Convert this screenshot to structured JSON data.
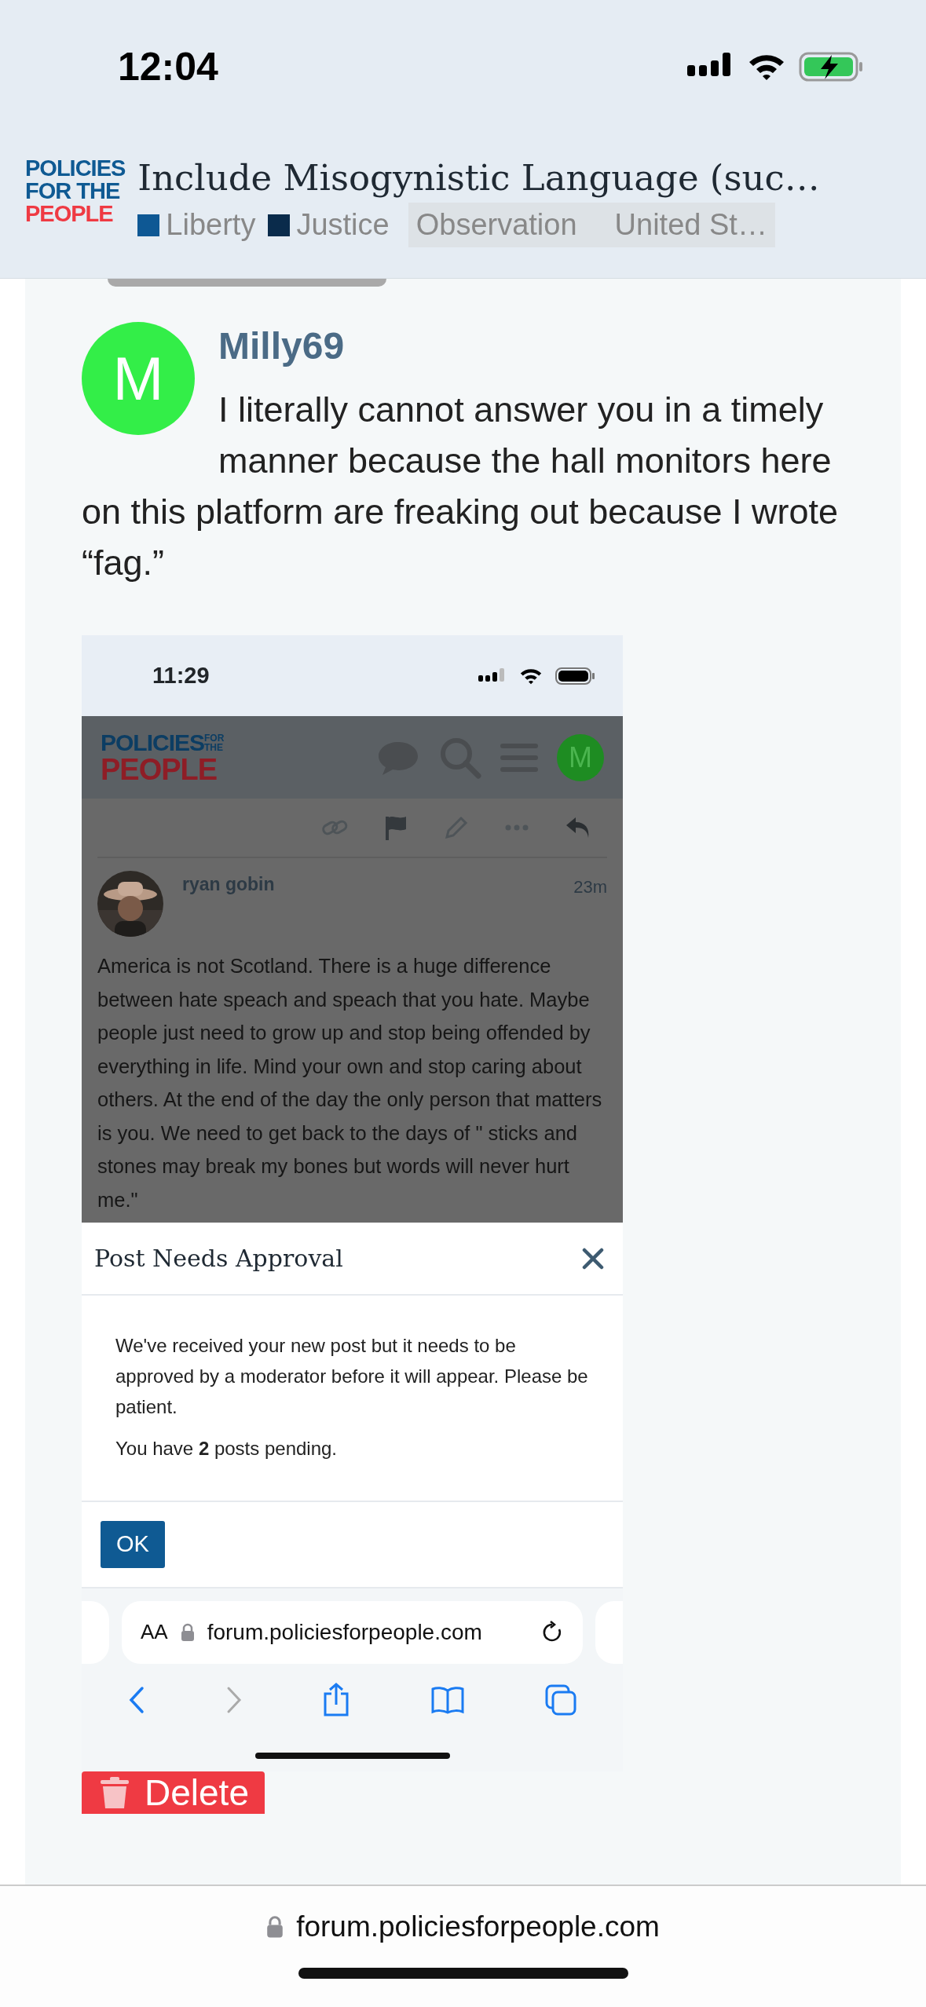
{
  "status_bar": {
    "time": "12:04"
  },
  "header": {
    "logo_lines": [
      "POLICIES",
      "FOR THE",
      "PEOPLE"
    ],
    "title": "Include Misogynistic Language (suc…",
    "tags": [
      {
        "label": "Liberty",
        "kind": "category",
        "color": "#0e5894"
      },
      {
        "label": "Justice",
        "kind": "category",
        "color": "#0a2b4b"
      },
      {
        "label": "Observation",
        "kind": "tag"
      },
      {
        "label": "United St…",
        "kind": "tag"
      }
    ]
  },
  "post": {
    "author": "Milly69",
    "avatar_letter": "M",
    "text": "I literally cannot answer you in a timely manner because the hall monitors here on this platform are freaking out because I wrote “fag.”",
    "image": {
      "time": "11:29",
      "logo_lines": [
        "POLICIES",
        "FOR",
        "THE",
        "PEOPLE"
      ],
      "user_letter": "M",
      "quoted_post": {
        "author": "ryan gobin",
        "age": "23m",
        "text": "America is not Scotland. There is a huge difference between hate speach and speach that you hate. Maybe people just need to grow up and stop being offended by everything in life. Mind your own and stop caring about others. At the end of the day the only person that matters is you. We need to get back to the days of \" sticks and stones may break my bones but words will never hurt me.\""
      },
      "modal": {
        "title": "Post Needs Approval",
        "message": "We've received your new post but it needs to be approved by a moderator before it will appear. Please be patient.",
        "pending": "You have **2** posts pending.",
        "button": "OK"
      },
      "browser": {
        "text_size": "AA",
        "url": "forum.policiesforpeople.com"
      }
    },
    "delete_button": "Delete"
  },
  "browser": {
    "url": "forum.policiesforpeople.com"
  }
}
